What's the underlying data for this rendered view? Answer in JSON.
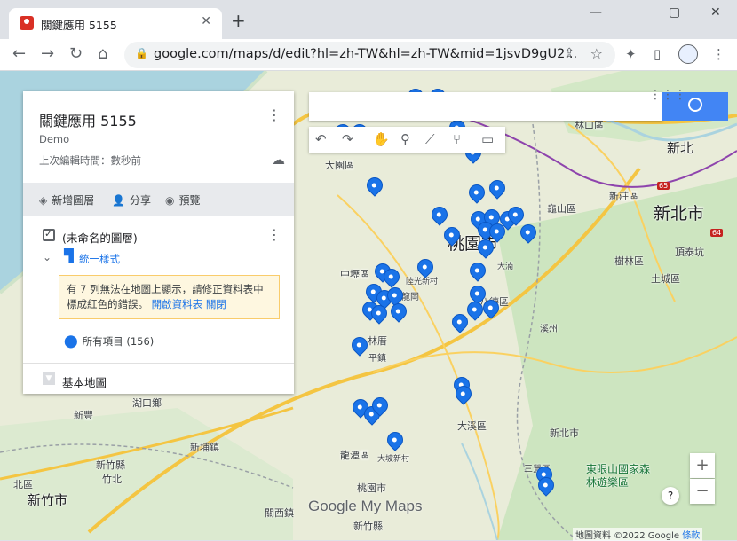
{
  "browser": {
    "tab_title": "關鍵應用 5155",
    "close_tab": "✕",
    "new_tab": "+",
    "minimize": "—",
    "maximize": "▢",
    "close_window": "✕",
    "back": "←",
    "forward": "→",
    "reload": "↻",
    "home": "⌂",
    "lock": "🔒",
    "url": "google.com/maps/d/edit?hl=zh-TW&hl=zh-TW&mid=1jsvD9gU2...",
    "share": "⇪",
    "star": "☆",
    "extensions": "✦",
    "sidepanel": "▯",
    "more": "⋮"
  },
  "panel": {
    "title": "關鍵應用 5155",
    "description": "Demo",
    "last_edit": "上次編輯時間：數秒前",
    "menu": "⋮",
    "cloud": "☁",
    "actions": {
      "add_layer_icon": "layers-icon",
      "add_layer": "新增圖層",
      "share": "分享",
      "preview": "預覽"
    },
    "layer": {
      "name": "(未命名的圖層)",
      "menu": "⋮",
      "caret": "⌄",
      "style": "統一樣式",
      "warning": "有 7 列無法在地圖上顯示，請修正資料表中標成紅色的錯誤。",
      "open_sheet": "開啟資料表",
      "close": "關閉",
      "all_items": "所有項目 (156)"
    },
    "basemap": "基本地圖"
  },
  "map": {
    "places": [
      {
        "text": "大園區"
      },
      {
        "text": "林口區"
      },
      {
        "text": "新北"
      },
      {
        "text": "新莊區"
      },
      {
        "text": "龜山區"
      },
      {
        "text": "新北市"
      },
      {
        "text": "樹林區"
      },
      {
        "text": "頂泰坑"
      },
      {
        "text": "土城區"
      },
      {
        "text": "中壢區"
      },
      {
        "text": "陸光新村"
      },
      {
        "text": "龍岡"
      },
      {
        "text": "桃園市"
      },
      {
        "text": "大湳"
      },
      {
        "text": "八德區"
      },
      {
        "text": "溪州"
      },
      {
        "text": "林厝"
      },
      {
        "text": "湖口鄉"
      },
      {
        "text": "新豐"
      },
      {
        "text": "新埔鎮"
      },
      {
        "text": "新竹縣"
      },
      {
        "text": "竹北"
      },
      {
        "text": "新竹市"
      },
      {
        "text": "北區"
      },
      {
        "text": "龍潭區"
      },
      {
        "text": "大坡新村"
      },
      {
        "text": "大溪區"
      },
      {
        "text": "新北市"
      },
      {
        "text": "桃園市"
      },
      {
        "text": "關西鎮"
      },
      {
        "text": "新竹縣"
      },
      {
        "text": "平鎮"
      },
      {
        "text": "三鶯區"
      },
      {
        "text": "東眼山國家森林遊樂區"
      }
    ],
    "zoom_in": "+",
    "zoom_out": "−",
    "help": "?",
    "logo": "Google My Maps",
    "attribution": "地圖資料 ©2022 Google",
    "terms": "條款"
  }
}
